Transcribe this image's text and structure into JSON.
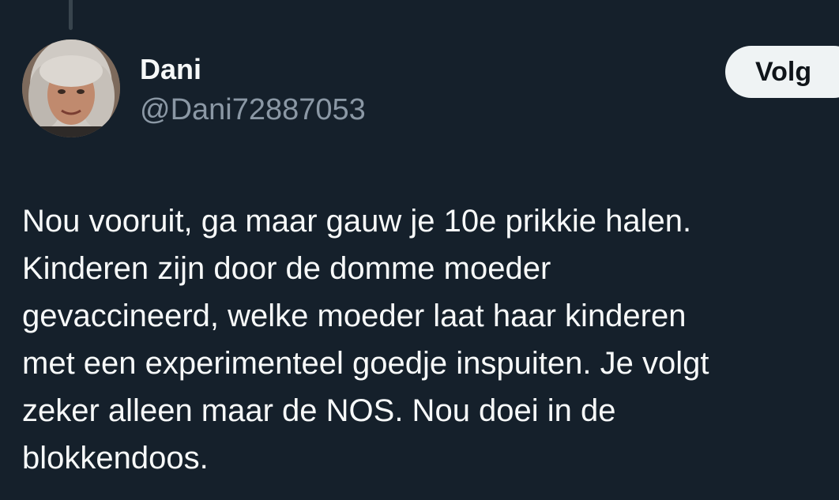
{
  "tweet": {
    "author": {
      "display_name": "Dani",
      "handle": "@Dani72887053"
    },
    "follow_label": "Volg",
    "text_lines": [
      "Nou vooruit, ga maar gauw je 10e prikkie halen.",
      "Kinderen zijn door de domme moeder",
      "gevaccineerd, welke moeder laat haar kinderen",
      "met een experimenteel goedje inspuiten. Je volgt",
      "zeker alleen maar de NOS. Nou doei in de",
      "blokkendoos."
    ]
  },
  "colors": {
    "background": "#15202b",
    "text_primary": "#f7f9f9",
    "text_secondary": "#8b98a5",
    "button_bg": "#eff3f4",
    "button_text": "#0f1419"
  }
}
